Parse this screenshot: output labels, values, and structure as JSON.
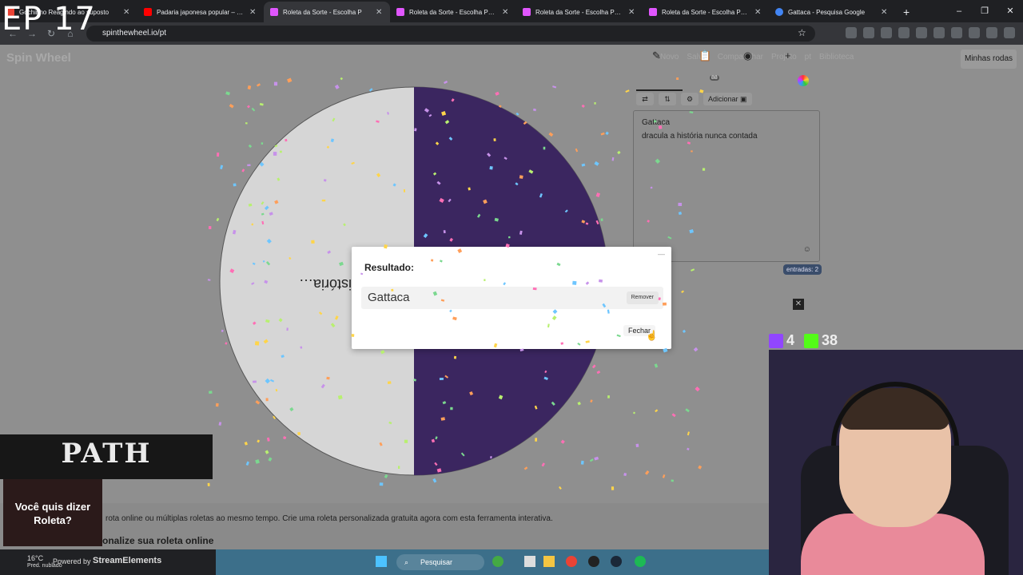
{
  "overlay": {
    "episode": "EP 17"
  },
  "browser": {
    "tabs": [
      {
        "title": "Gochinho Reagindo ao suposto",
        "color": "#ea4335",
        "active": false
      },
      {
        "title": "Padaria japonesa popular – avó",
        "color": "#ff0000",
        "active": false
      },
      {
        "title": "Roleta da Sorte - Escolha P",
        "color": "#e056fd",
        "active": true
      },
      {
        "title": "Roleta da Sorte - Escolha Perso",
        "color": "#e056fd",
        "active": false
      },
      {
        "title": "Roleta da Sorte - Escolha Perso",
        "color": "#e056fd",
        "active": false
      },
      {
        "title": "Roleta da Sorte - Escolha Perso",
        "color": "#e056fd",
        "active": false
      },
      {
        "title": "Gattaca - Pesquisa Google",
        "color": "#4285f4",
        "active": false
      }
    ],
    "url": "spinthewheel.io/pt"
  },
  "site": {
    "logo": "Spin Wheel",
    "nav": [
      "Novo",
      "Salvar",
      "Compartilhar",
      "Projeto",
      "pt",
      "Biblioteca"
    ],
    "my_wheels": "Minhas rodas"
  },
  "wheel": {
    "slice_label": "dracula a história nunca contada",
    "colors": {
      "left": "#e3e3e3",
      "right": "#3b2660"
    }
  },
  "panel": {
    "add_label": "Adicionar",
    "tab_badge": "88",
    "entries": [
      "Gattaca",
      "dracula a história nunca contada"
    ],
    "entries_count": "entradas: 2"
  },
  "modal": {
    "title": "Resultado:",
    "result": "Gattaca",
    "remove": "Remover",
    "close": "Fechar"
  },
  "page_text": {
    "line1": "rota online ou múltiplas roletas ao mesmo tempo. Crie uma roleta personalizada gratuita agora com esta ferramenta interativa.",
    "line2": "onalize sua roleta online"
  },
  "stream": {
    "twitch_count": "4",
    "kick_count": "38",
    "path_title": "PATH",
    "roleta_text": "Você quis dizer Roleta?",
    "weather_temp": "16°C",
    "weather_desc": "Pred. nublado",
    "powered_by": "Powered by",
    "brand": "StreamElements",
    "taskbar_search": "Pesquisar"
  }
}
